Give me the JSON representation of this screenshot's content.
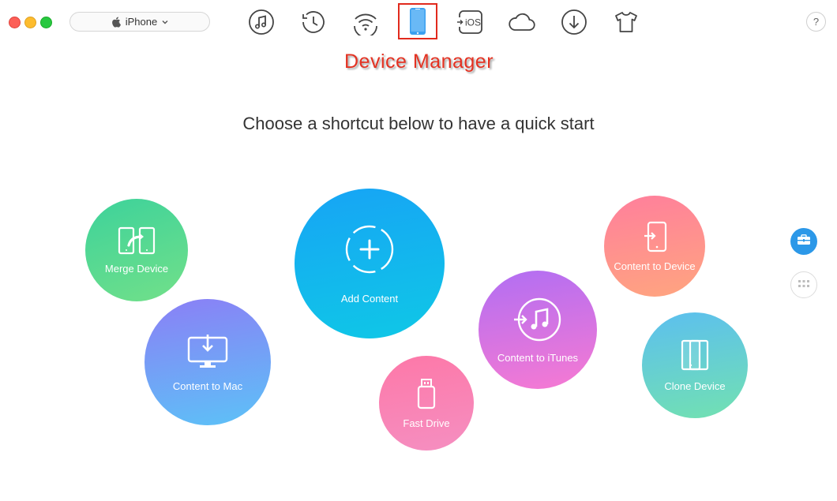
{
  "window": {
    "controls": [
      "close",
      "minimize",
      "maximize"
    ]
  },
  "device_selector": {
    "icon": "apple-icon",
    "label": "iPhone",
    "dropdown_icon": "chevron-down-icon"
  },
  "toolbar": {
    "items": [
      {
        "name": "music-icon"
      },
      {
        "name": "history-icon"
      },
      {
        "name": "wifi-sync-icon"
      },
      {
        "name": "device-icon",
        "active": true
      },
      {
        "name": "to-ios-icon",
        "label": "iOS"
      },
      {
        "name": "cloud-icon"
      },
      {
        "name": "download-icon"
      },
      {
        "name": "shirt-icon"
      }
    ],
    "help_label": "?"
  },
  "annotation": {
    "text": "Device Manager",
    "color": "#e43222"
  },
  "main": {
    "headline": "Choose a shortcut below to have a quick start",
    "shortcuts": [
      {
        "id": "merge",
        "label": "Merge Device",
        "icon": "merge-icon"
      },
      {
        "id": "mac",
        "label": "Content to Mac",
        "icon": "monitor-download-icon"
      },
      {
        "id": "add",
        "label": "Add Content",
        "icon": "plus-icon"
      },
      {
        "id": "fast",
        "label": "Fast Drive",
        "icon": "usb-drive-icon"
      },
      {
        "id": "itunes",
        "label": "Content to iTunes",
        "icon": "itunes-icon"
      },
      {
        "id": "todev",
        "label": "Content to Device",
        "icon": "phone-import-icon"
      },
      {
        "id": "clone",
        "label": "Clone Device",
        "icon": "clone-icon"
      }
    ]
  },
  "side": {
    "toolkit_icon": "toolbox-icon",
    "grid_icon": "grid-icon"
  },
  "colors": {
    "accent": "#2c98e8",
    "active_border": "#e12a1d"
  }
}
